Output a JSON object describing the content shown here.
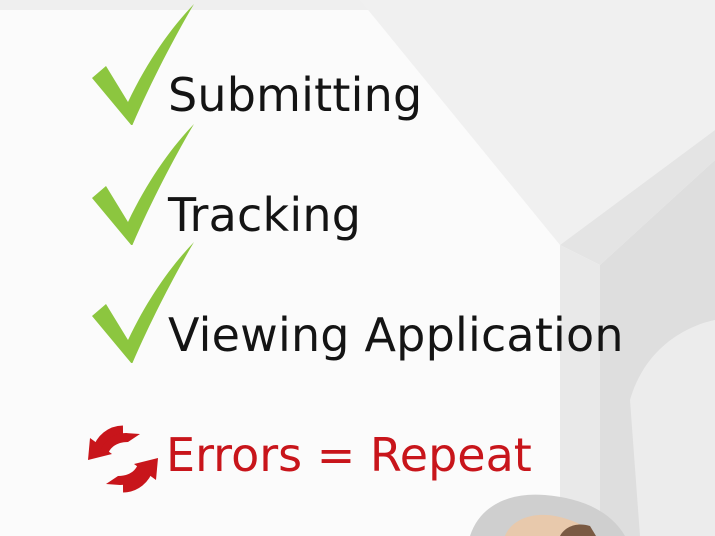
{
  "checklist": {
    "items": [
      {
        "label": "Submitting",
        "icon": "checkmark-icon"
      },
      {
        "label": "Tracking",
        "icon": "checkmark-icon"
      },
      {
        "label": "Viewing Application",
        "icon": "checkmark-icon"
      }
    ],
    "error": {
      "label": "Errors = Repeat",
      "icon": "refresh-icon"
    }
  },
  "colors": {
    "check_green": "#8cc63f",
    "error_red": "#c8151b",
    "text": "#141414"
  }
}
